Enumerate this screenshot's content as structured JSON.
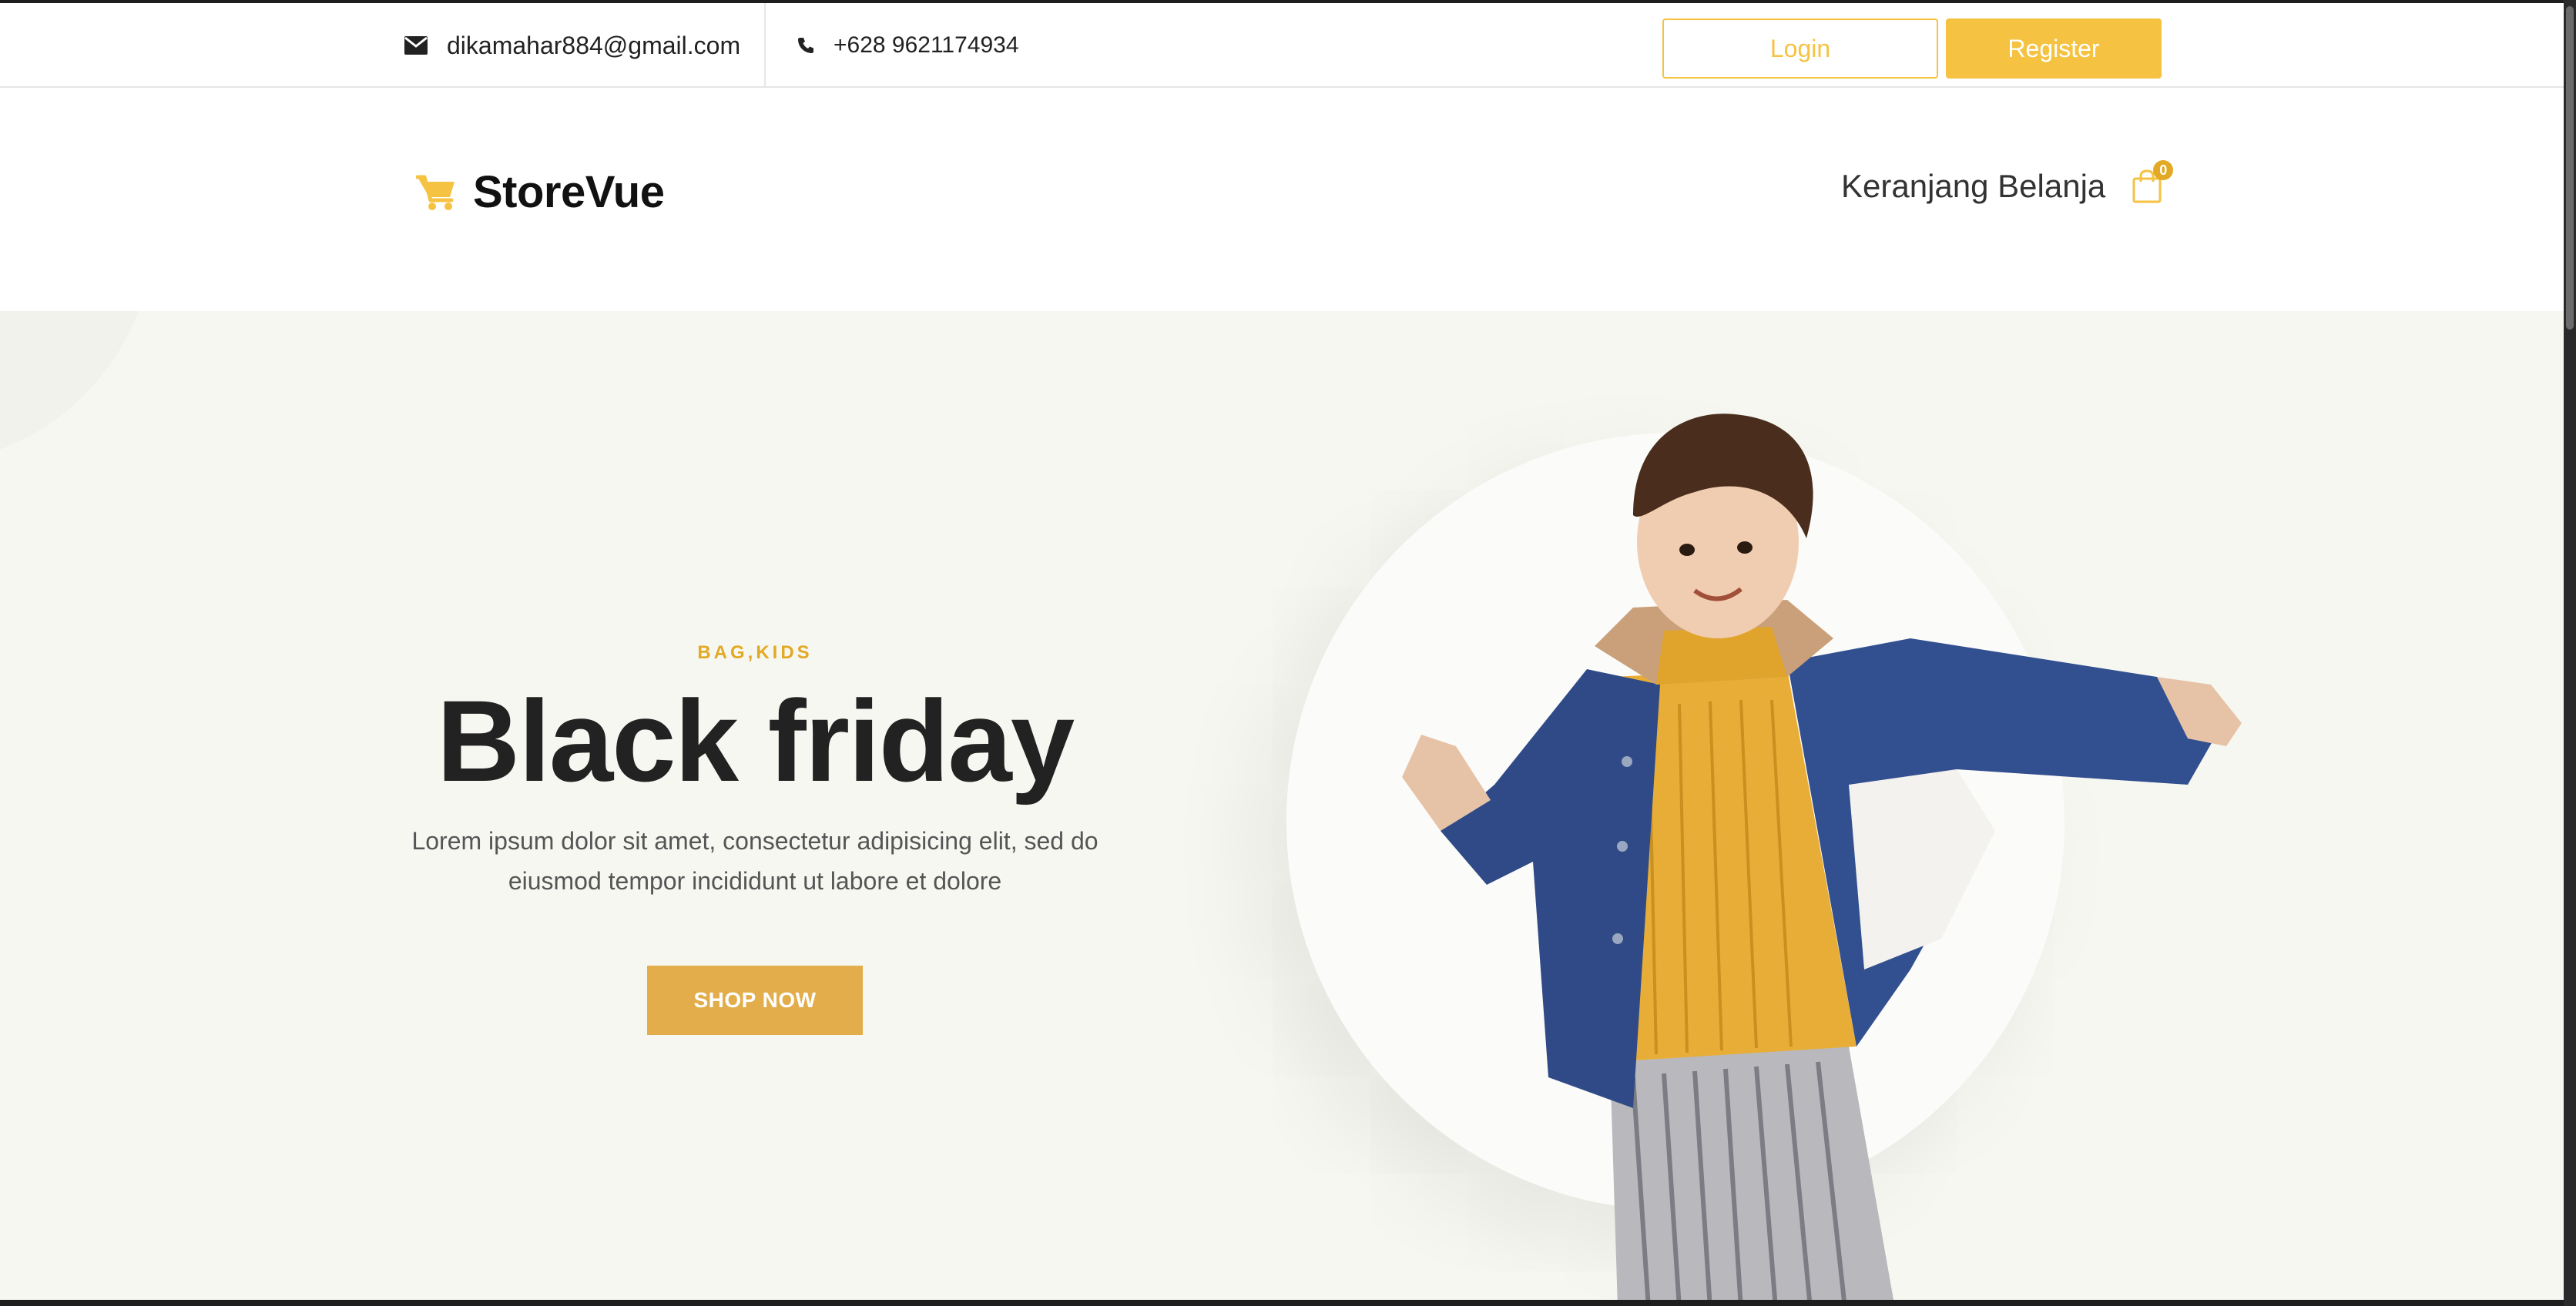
{
  "topbar": {
    "email": "dikamahar884@gmail.com",
    "phone": "+628 9621174934",
    "login_label": "Login",
    "register_label": "Register",
    "icons": {
      "email": "envelope-icon",
      "phone": "phone-icon"
    }
  },
  "header": {
    "brand": "StoreVue",
    "brand_icon": "cart-icon",
    "cart_label": "Keranjang Belanja",
    "cart_count": "0",
    "cart_icon": "shopping-bag-icon"
  },
  "hero": {
    "eyebrow": "BAG,KIDS",
    "title": "Black friday",
    "description": "Lorem ipsum dolor sit amet, consectetur adipisicing elit, sed do eiusmod tempor incididunt ut labore et dolore",
    "cta_label": "SHOP NOW",
    "image": "kid-in-denim-jacket-photo"
  },
  "colors": {
    "accent": "#f5c242",
    "accent_dark": "#e2a924",
    "hero_bg": "#f7f7f2",
    "text": "#222222"
  }
}
